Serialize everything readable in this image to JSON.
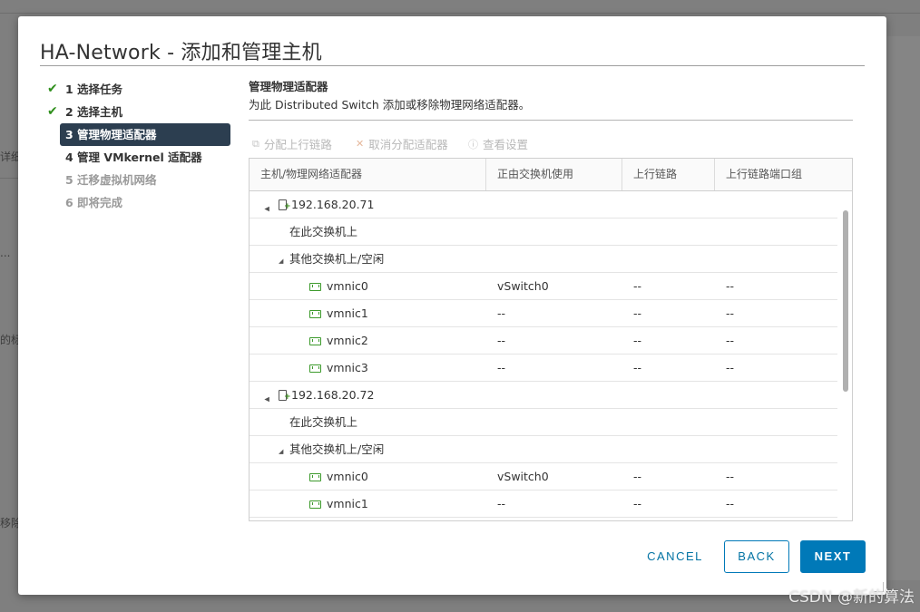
{
  "background": {
    "fragments": [
      "详细",
      "...",
      "的标",
      "移除"
    ]
  },
  "dialog": {
    "title": "HA-Network - 添加和管理主机"
  },
  "steps": [
    {
      "label": "1 选择任务",
      "state": "done"
    },
    {
      "label": "2 选择主机",
      "state": "done"
    },
    {
      "label": "3 管理物理适配器",
      "state": "active"
    },
    {
      "label": "4 管理 VMkernel 适配器",
      "state": "upcoming"
    },
    {
      "label": "5 迁移虚拟机网络",
      "state": "disabled"
    },
    {
      "label": "6 即将完成",
      "state": "disabled"
    }
  ],
  "content": {
    "title": "管理物理适配器",
    "subtitle": "为此 Distributed Switch 添加或移除物理网络适配器。"
  },
  "toolbar": {
    "assign_uplink": "分配上行链路",
    "unassign_adapter": "取消分配适配器",
    "view_settings": "查看设置"
  },
  "grid": {
    "columns": [
      "主机/物理网络适配器",
      "正由交换机使用",
      "上行链路",
      "上行链路端口组"
    ],
    "rows": [
      {
        "kind": "host",
        "name": "192.168.20.71",
        "in_use_by": "",
        "uplink": "",
        "uplink_pg": ""
      },
      {
        "kind": "group",
        "name": "在此交换机上",
        "in_use_by": "",
        "uplink": "",
        "uplink_pg": ""
      },
      {
        "kind": "group-expanded",
        "name": "其他交换机上/空闲",
        "in_use_by": "",
        "uplink": "",
        "uplink_pg": ""
      },
      {
        "kind": "nic",
        "name": "vmnic0",
        "in_use_by": "vSwitch0",
        "uplink": "--",
        "uplink_pg": "--"
      },
      {
        "kind": "nic",
        "name": "vmnic1",
        "in_use_by": "--",
        "uplink": "--",
        "uplink_pg": "--"
      },
      {
        "kind": "nic",
        "name": "vmnic2",
        "in_use_by": "--",
        "uplink": "--",
        "uplink_pg": "--"
      },
      {
        "kind": "nic",
        "name": "vmnic3",
        "in_use_by": "--",
        "uplink": "--",
        "uplink_pg": "--"
      },
      {
        "kind": "host",
        "name": "192.168.20.72",
        "in_use_by": "",
        "uplink": "",
        "uplink_pg": ""
      },
      {
        "kind": "group",
        "name": "在此交换机上",
        "in_use_by": "",
        "uplink": "",
        "uplink_pg": ""
      },
      {
        "kind": "group-expanded",
        "name": "其他交换机上/空闲",
        "in_use_by": "",
        "uplink": "",
        "uplink_pg": ""
      },
      {
        "kind": "nic",
        "name": "vmnic0",
        "in_use_by": "vSwitch0",
        "uplink": "--",
        "uplink_pg": "--"
      },
      {
        "kind": "nic",
        "name": "vmnic1",
        "in_use_by": "--",
        "uplink": "--",
        "uplink_pg": "--"
      }
    ]
  },
  "buttons": {
    "cancel": "CANCEL",
    "back": "BACK",
    "next": "NEXT"
  },
  "watermark": "CSDN @新的算法",
  "colors": {
    "accent": "#0079b8",
    "active_step_bg": "#2c3e50",
    "check": "#2f8f1c",
    "nic_icon": "#3c9a2b"
  }
}
